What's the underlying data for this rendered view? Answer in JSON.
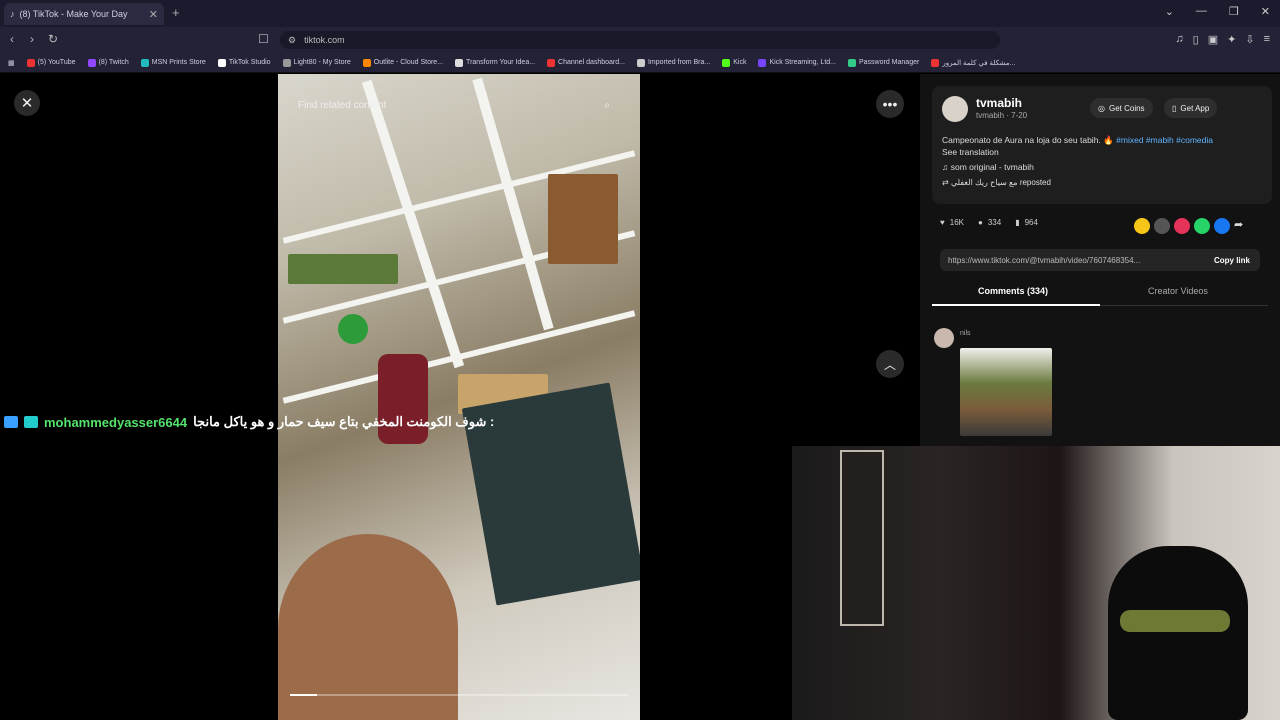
{
  "browser": {
    "tab_title": "(8) TikTok - Make Your Day",
    "url": "tiktok.com",
    "bookmarks": [
      {
        "label": "(5) YouTube",
        "color": "#e33"
      },
      {
        "label": "(8) Twitch",
        "color": "#9146ff"
      },
      {
        "label": "MSN Prints Store",
        "color": "#2bb"
      },
      {
        "label": "TikTok Studio",
        "color": "#fff"
      },
      {
        "label": "Light80 - My Store",
        "color": "#999"
      },
      {
        "label": "Outlite - Cloud Store...",
        "color": "#f80"
      },
      {
        "label": "Transform Your Idea...",
        "color": "#ddd"
      },
      {
        "label": "Channel dashboard...",
        "color": "#e33"
      },
      {
        "label": "Imported from Bra...",
        "color": "#ccc"
      },
      {
        "label": "Kick",
        "color": "#53fc18"
      },
      {
        "label": "Kick Streaming, Ltd...",
        "color": "#7744ff"
      },
      {
        "label": "Password Manager",
        "color": "#3c8"
      },
      {
        "label": "مشكلة في كلمة المرور...",
        "color": "#e33"
      }
    ]
  },
  "video": {
    "search_placeholder": "Find related content",
    "progress": 0.08
  },
  "overlay": {
    "chat_user": "mohammedyasser6644",
    "chat_message": "شوف الكومنت المخفي بتاع سيف حمار و هو ياكل مانجا :"
  },
  "creator": {
    "name": "tvmabih",
    "handle": "tvmabih · 7-20",
    "get_coins": "Get Coins",
    "get_app": "Get App",
    "description": "Campeonato de Aura na loja do seu tabih.",
    "hashtags": "#mixed #mabih #comedia",
    "see_translation": "See translation",
    "sound": "som original - tvmabih",
    "repost_label": "مع سياح ريك الغفلي reposted"
  },
  "stats": {
    "likes": "16K",
    "comments": "334",
    "saves": "964"
  },
  "share_colors": [
    "#f5c518",
    "#555",
    "#e6335a",
    "#25d366",
    "#1877f2"
  ],
  "share_link": "https://www.tiktok.com/@tvmabih/video/7607468354...",
  "copy_link": "Copy link",
  "tabs": {
    "comments": "Comments (334)",
    "creator_videos": "Creator Videos"
  },
  "comment": {
    "user": "nils"
  }
}
